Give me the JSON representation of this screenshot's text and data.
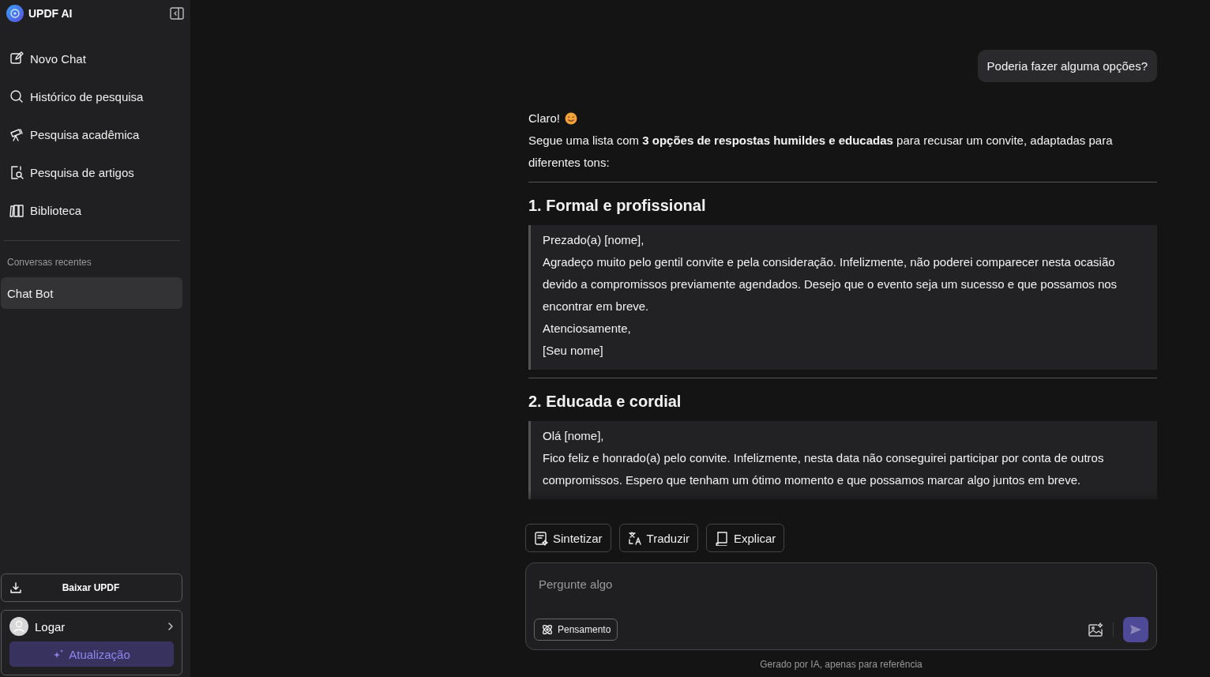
{
  "sidebar": {
    "brand": "UPDF AI",
    "nav": [
      {
        "label": "Novo Chat"
      },
      {
        "label": "Histórico de pesquisa"
      },
      {
        "label": "Pesquisa acadêmica"
      },
      {
        "label": "Pesquisa de artigos"
      },
      {
        "label": "Biblioteca"
      }
    ],
    "section_title": "Conversas recentes",
    "recent": [
      {
        "label": "Chat Bot",
        "selected": true
      }
    ],
    "download_button": "Baixar UPDF",
    "account": {
      "login": "Logar",
      "upgrade": "Atualização"
    }
  },
  "chat": {
    "user_message": "Poderia fazer alguma opções?",
    "reply": {
      "intro": "Claro!",
      "lead": "Segue uma lista com **3 opções de respostas humildes e educadas** para recusar um convite, adaptadas para diferentes tons:",
      "sections": [
        {
          "heading": "1. Formal e profissional",
          "lines": [
            "Prezado(a) [nome],",
            "Agradeço muito pelo gentil convite e pela consideração. Infelizmente, não poderei comparecer nesta ocasião devido a compromissos previamente agendados. Desejo que o evento seja um sucesso e que possamos nos encontrar em breve.",
            "Atenciosamente,",
            "[Seu nome]"
          ]
        },
        {
          "heading": "2. Educada e cordial",
          "lines": [
            "Olá [nome],",
            "Fico feliz e honrado(a) pelo convite. Infelizmente, nesta data não conseguirei participar por conta de outros compromissos. Espero que tenham um ótimo momento e que possamos marcar algo juntos em breve."
          ]
        }
      ]
    }
  },
  "actions": [
    {
      "label": "Sintetizar"
    },
    {
      "label": "Traduzir"
    },
    {
      "label": "Explicar"
    }
  ],
  "composer": {
    "placeholder": "Pergunte algo",
    "mode_button": "Pensamento"
  },
  "footer": "Gerado por IA, apenas para referência"
}
